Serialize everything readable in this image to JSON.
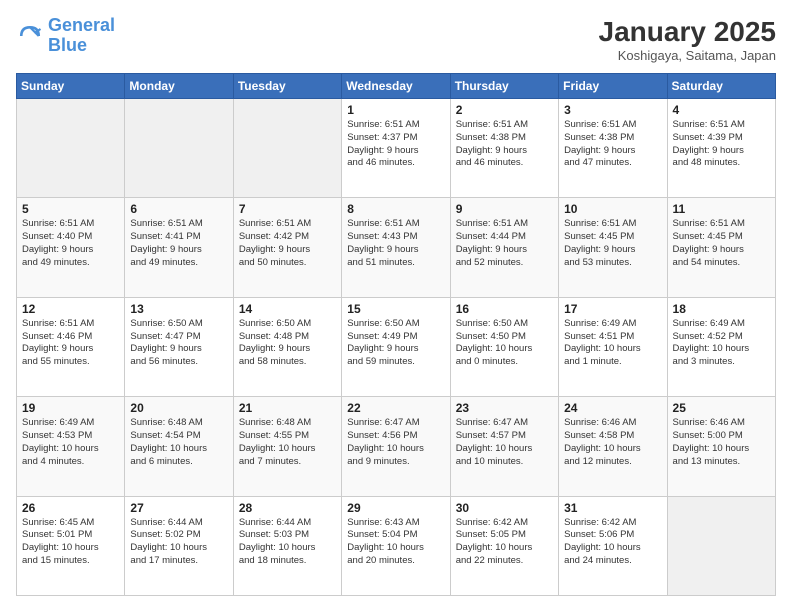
{
  "logo": {
    "line1": "General",
    "line2": "Blue"
  },
  "title": "January 2025",
  "location": "Koshigaya, Saitama, Japan",
  "days_of_week": [
    "Sunday",
    "Monday",
    "Tuesday",
    "Wednesday",
    "Thursday",
    "Friday",
    "Saturday"
  ],
  "weeks": [
    [
      {
        "num": "",
        "info": "",
        "empty": true
      },
      {
        "num": "",
        "info": "",
        "empty": true
      },
      {
        "num": "",
        "info": "",
        "empty": true
      },
      {
        "num": "1",
        "info": "Sunrise: 6:51 AM\nSunset: 4:37 PM\nDaylight: 9 hours\nand 46 minutes.",
        "empty": false
      },
      {
        "num": "2",
        "info": "Sunrise: 6:51 AM\nSunset: 4:38 PM\nDaylight: 9 hours\nand 46 minutes.",
        "empty": false
      },
      {
        "num": "3",
        "info": "Sunrise: 6:51 AM\nSunset: 4:38 PM\nDaylight: 9 hours\nand 47 minutes.",
        "empty": false
      },
      {
        "num": "4",
        "info": "Sunrise: 6:51 AM\nSunset: 4:39 PM\nDaylight: 9 hours\nand 48 minutes.",
        "empty": false
      }
    ],
    [
      {
        "num": "5",
        "info": "Sunrise: 6:51 AM\nSunset: 4:40 PM\nDaylight: 9 hours\nand 49 minutes.",
        "empty": false
      },
      {
        "num": "6",
        "info": "Sunrise: 6:51 AM\nSunset: 4:41 PM\nDaylight: 9 hours\nand 49 minutes.",
        "empty": false
      },
      {
        "num": "7",
        "info": "Sunrise: 6:51 AM\nSunset: 4:42 PM\nDaylight: 9 hours\nand 50 minutes.",
        "empty": false
      },
      {
        "num": "8",
        "info": "Sunrise: 6:51 AM\nSunset: 4:43 PM\nDaylight: 9 hours\nand 51 minutes.",
        "empty": false
      },
      {
        "num": "9",
        "info": "Sunrise: 6:51 AM\nSunset: 4:44 PM\nDaylight: 9 hours\nand 52 minutes.",
        "empty": false
      },
      {
        "num": "10",
        "info": "Sunrise: 6:51 AM\nSunset: 4:45 PM\nDaylight: 9 hours\nand 53 minutes.",
        "empty": false
      },
      {
        "num": "11",
        "info": "Sunrise: 6:51 AM\nSunset: 4:45 PM\nDaylight: 9 hours\nand 54 minutes.",
        "empty": false
      }
    ],
    [
      {
        "num": "12",
        "info": "Sunrise: 6:51 AM\nSunset: 4:46 PM\nDaylight: 9 hours\nand 55 minutes.",
        "empty": false
      },
      {
        "num": "13",
        "info": "Sunrise: 6:50 AM\nSunset: 4:47 PM\nDaylight: 9 hours\nand 56 minutes.",
        "empty": false
      },
      {
        "num": "14",
        "info": "Sunrise: 6:50 AM\nSunset: 4:48 PM\nDaylight: 9 hours\nand 58 minutes.",
        "empty": false
      },
      {
        "num": "15",
        "info": "Sunrise: 6:50 AM\nSunset: 4:49 PM\nDaylight: 9 hours\nand 59 minutes.",
        "empty": false
      },
      {
        "num": "16",
        "info": "Sunrise: 6:50 AM\nSunset: 4:50 PM\nDaylight: 10 hours\nand 0 minutes.",
        "empty": false
      },
      {
        "num": "17",
        "info": "Sunrise: 6:49 AM\nSunset: 4:51 PM\nDaylight: 10 hours\nand 1 minute.",
        "empty": false
      },
      {
        "num": "18",
        "info": "Sunrise: 6:49 AM\nSunset: 4:52 PM\nDaylight: 10 hours\nand 3 minutes.",
        "empty": false
      }
    ],
    [
      {
        "num": "19",
        "info": "Sunrise: 6:49 AM\nSunset: 4:53 PM\nDaylight: 10 hours\nand 4 minutes.",
        "empty": false
      },
      {
        "num": "20",
        "info": "Sunrise: 6:48 AM\nSunset: 4:54 PM\nDaylight: 10 hours\nand 6 minutes.",
        "empty": false
      },
      {
        "num": "21",
        "info": "Sunrise: 6:48 AM\nSunset: 4:55 PM\nDaylight: 10 hours\nand 7 minutes.",
        "empty": false
      },
      {
        "num": "22",
        "info": "Sunrise: 6:47 AM\nSunset: 4:56 PM\nDaylight: 10 hours\nand 9 minutes.",
        "empty": false
      },
      {
        "num": "23",
        "info": "Sunrise: 6:47 AM\nSunset: 4:57 PM\nDaylight: 10 hours\nand 10 minutes.",
        "empty": false
      },
      {
        "num": "24",
        "info": "Sunrise: 6:46 AM\nSunset: 4:58 PM\nDaylight: 10 hours\nand 12 minutes.",
        "empty": false
      },
      {
        "num": "25",
        "info": "Sunrise: 6:46 AM\nSunset: 5:00 PM\nDaylight: 10 hours\nand 13 minutes.",
        "empty": false
      }
    ],
    [
      {
        "num": "26",
        "info": "Sunrise: 6:45 AM\nSunset: 5:01 PM\nDaylight: 10 hours\nand 15 minutes.",
        "empty": false
      },
      {
        "num": "27",
        "info": "Sunrise: 6:44 AM\nSunset: 5:02 PM\nDaylight: 10 hours\nand 17 minutes.",
        "empty": false
      },
      {
        "num": "28",
        "info": "Sunrise: 6:44 AM\nSunset: 5:03 PM\nDaylight: 10 hours\nand 18 minutes.",
        "empty": false
      },
      {
        "num": "29",
        "info": "Sunrise: 6:43 AM\nSunset: 5:04 PM\nDaylight: 10 hours\nand 20 minutes.",
        "empty": false
      },
      {
        "num": "30",
        "info": "Sunrise: 6:42 AM\nSunset: 5:05 PM\nDaylight: 10 hours\nand 22 minutes.",
        "empty": false
      },
      {
        "num": "31",
        "info": "Sunrise: 6:42 AM\nSunset: 5:06 PM\nDaylight: 10 hours\nand 24 minutes.",
        "empty": false
      },
      {
        "num": "",
        "info": "",
        "empty": true
      }
    ]
  ]
}
